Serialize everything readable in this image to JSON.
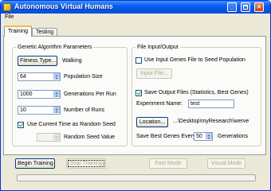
{
  "window": {
    "title": "Autonomous Virtual Humans",
    "menu": [
      {
        "label": "File"
      }
    ]
  },
  "tabs": [
    {
      "label": "Training",
      "active": true
    },
    {
      "label": "Testing",
      "active": false
    }
  ],
  "ga": {
    "legend": "Genetic Algorithm Parameters",
    "fitness_button": "Fitness Type...",
    "fitness_value": "Walking",
    "population": {
      "value": "64",
      "label": "Population Size"
    },
    "generations": {
      "value": "1000",
      "label": "Generations Per Run"
    },
    "runs": {
      "value": "10",
      "label": "Number of Runs"
    },
    "use_time_seed": {
      "label": "Use Current Time as Random Seed",
      "checked": true
    },
    "seed": {
      "value": "",
      "label": "Random Seed Value"
    }
  },
  "io": {
    "legend": "File Input/Output",
    "use_input_genes": {
      "label": "Use Input Genes File to Seed Population",
      "checked": false
    },
    "input_file_button": "Input File...",
    "save_output": {
      "label": "Save Output Files (Statistics, Best Genes)",
      "checked": true
    },
    "experiment_name": {
      "label": "Experiment Name:",
      "value": "test"
    },
    "location_button": "Location...",
    "location_path": "...\\Desktop\\myResearch\\werve",
    "save_best": {
      "label": "Save Best Genes Every",
      "value": "50",
      "suffix": "Generations"
    }
  },
  "actions": {
    "begin": "Begin Training",
    "stop": "Stop Training",
    "fast": "Fast Mode",
    "visual": "Visual Mode"
  },
  "colors": {
    "title_bar": "#0a5ee8",
    "close_button": "#c8411c",
    "window_face": "#ece9d8"
  },
  "icons": {
    "app": "app-icon",
    "minimize": "minimize-icon",
    "maximize": "maximize-icon",
    "close": "close-icon"
  }
}
